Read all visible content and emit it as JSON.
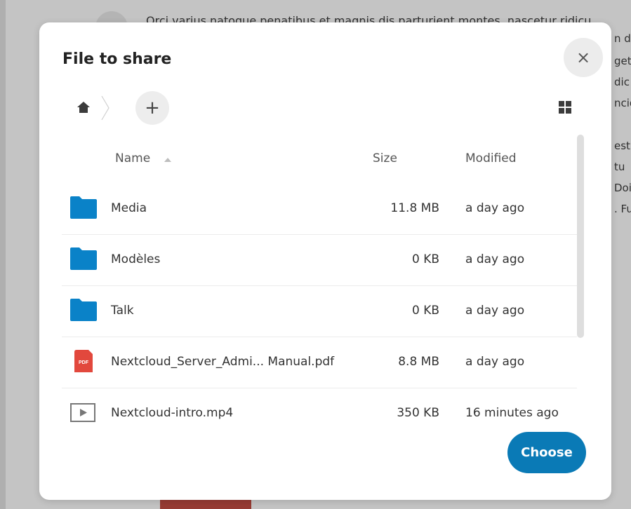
{
  "background": {
    "line1": "Orci varius natoque penatibus et magnis dis parturient montes, nascetur ridicu",
    "fragments": [
      "n d",
      "get",
      "dic",
      "ncid",
      "esti",
      "tu",
      "Doi",
      ". Fu"
    ]
  },
  "dialog": {
    "title": "File to share",
    "close_symbol": "×",
    "new_symbol": "+",
    "choose_label": "Choose",
    "columns": {
      "name": "Name",
      "size": "Size",
      "modified": "Modified"
    },
    "files": [
      {
        "name": "Media",
        "size": "11.8 MB",
        "modified": "a day ago",
        "icon": "folder-icon"
      },
      {
        "name": "Modèles",
        "size": "0 KB",
        "modified": "a day ago",
        "icon": "folder-icon"
      },
      {
        "name": "Talk",
        "size": "0 KB",
        "modified": "a day ago",
        "icon": "folder-icon"
      },
      {
        "name": "Nextcloud_Server_Admi... Manual.pdf",
        "size": "8.8 MB",
        "modified": "a day ago",
        "icon": "pdf-icon"
      },
      {
        "name": "Nextcloud-intro.mp4",
        "size": "350 KB",
        "modified": "16 minutes ago",
        "icon": "video-icon"
      }
    ],
    "pdf_icon_text": "PDF"
  },
  "colors": {
    "accent": "#0a7ab6",
    "folder": "#0a82c8",
    "pdf": "#e2483d"
  }
}
